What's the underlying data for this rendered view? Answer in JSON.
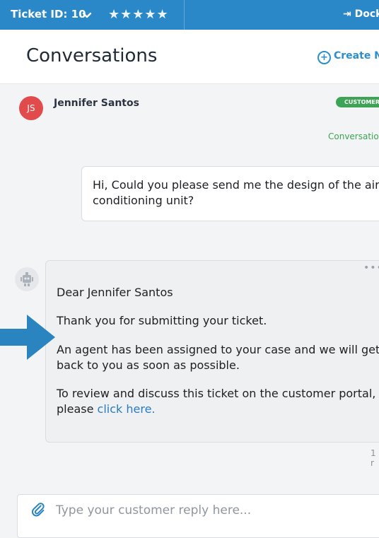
{
  "topbar": {
    "ticket_label": "Ticket ID: 10",
    "stars": "★★★★★",
    "dock_label": "Dock"
  },
  "header": {
    "title": "Conversations",
    "create_label": "Create Ne"
  },
  "message_customer": {
    "initials": "JS",
    "sender": "Jennifer Santos",
    "badge": "CUSTOMER",
    "conversation_link": "Conversatio",
    "text": "Hi, Could you please send me the design of the air conditioning unit?"
  },
  "message_bot": {
    "menu": "•••",
    "greeting": "Dear Jennifer Santos",
    "thanks": "Thank you for submitting your ticket.",
    "assigned": "An agent has been assigned to your case and we will get back to you as soon as possible.",
    "review_prefix": "To review and discuss this ticket on the customer portal, please ",
    "link_text": "click here.",
    "time": "1 r"
  },
  "reply": {
    "placeholder": "Type your customer reply here..."
  },
  "colors": {
    "topbar": "#2b88c8",
    "avatar": "#e14b4b",
    "badge": "#3ca454",
    "link": "#2a7bbf",
    "arrow": "#2a84bf"
  },
  "icons": [
    "chevron-down-icon",
    "star-icon",
    "dock-icon",
    "plus-circle-icon",
    "robot-icon",
    "more-icon",
    "arrow-right-icon",
    "paperclip-icon"
  ]
}
